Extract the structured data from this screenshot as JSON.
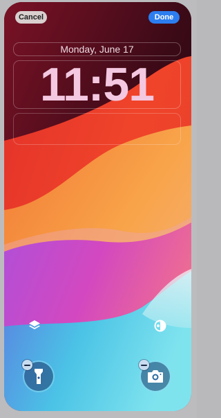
{
  "top_bar": {
    "cancel_label": "Cancel",
    "done_label": "Done"
  },
  "lock_screen": {
    "date": "Monday, June 17",
    "time": "11:51"
  },
  "icons": {
    "layers": "layers-icon",
    "style": "color-filter-icon",
    "flashlight": "flashlight-icon",
    "camera": "camera-icon",
    "remove": "minus-icon"
  },
  "colors": {
    "done_button": "#2c7ef0",
    "cancel_button": "#d9cfcf",
    "time_text": "#f3c8e0"
  }
}
